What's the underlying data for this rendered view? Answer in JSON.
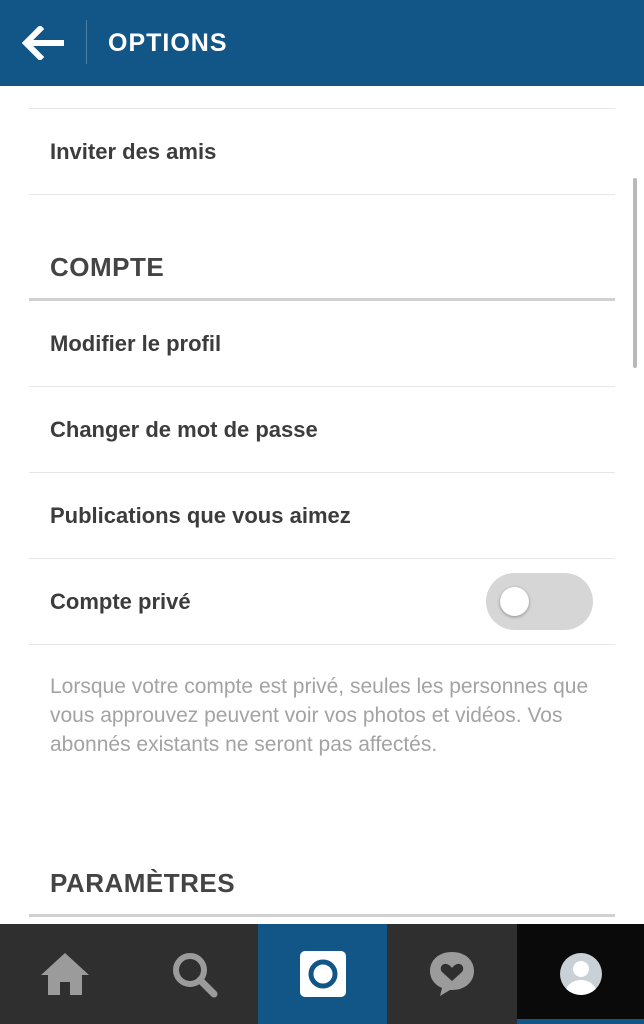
{
  "header": {
    "title": "OPTIONS",
    "back_icon": "arrow-left-icon",
    "background_color": "#125688"
  },
  "items": {
    "invite_friends": "Inviter des amis"
  },
  "account": {
    "section_title": "COMPTE",
    "items": [
      "Modifier le profil",
      "Changer de mot de passe",
      "Publications que vous aimez"
    ],
    "private_account": {
      "label": "Compte privé",
      "enabled": false
    },
    "private_description": "Lorsque votre compte est privé, seules les personnes que vous approuvez peuvent voir vos photos et vidéos. Vos abonnés existants ne seront pas affectés."
  },
  "settings": {
    "section_title": "PARAMÈTRES"
  },
  "bottom_nav": [
    {
      "icon": "home-icon",
      "active": false
    },
    {
      "icon": "search-icon",
      "active": false
    },
    {
      "icon": "camera-icon",
      "active": false
    },
    {
      "icon": "activity-heart-icon",
      "active": false
    },
    {
      "icon": "profile-avatar-icon",
      "active": true
    }
  ]
}
